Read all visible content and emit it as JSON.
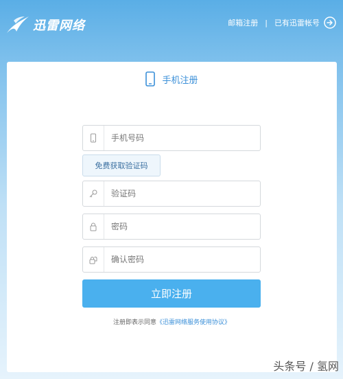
{
  "header": {
    "logo_text": "迅雷网络",
    "links": {
      "email_register": "邮箱注册",
      "separator": "|",
      "have_account": "已有迅雷帐号"
    }
  },
  "form": {
    "title": "手机注册",
    "phone_placeholder": "手机号码",
    "sms_button": "免费获取验证码",
    "code_placeholder": "验证码",
    "password_placeholder": "密码",
    "confirm_placeholder": "确认密码",
    "submit": "立即注册",
    "agreement_prefix": "注册即表示同意",
    "agreement_link": "《迅雷网络服务使用协议》"
  },
  "watermark": "头条号 / 氢网",
  "colors": {
    "accent": "#4ab0ee",
    "title_blue": "#3a8fd8",
    "header_blue": "#5aaee6"
  }
}
